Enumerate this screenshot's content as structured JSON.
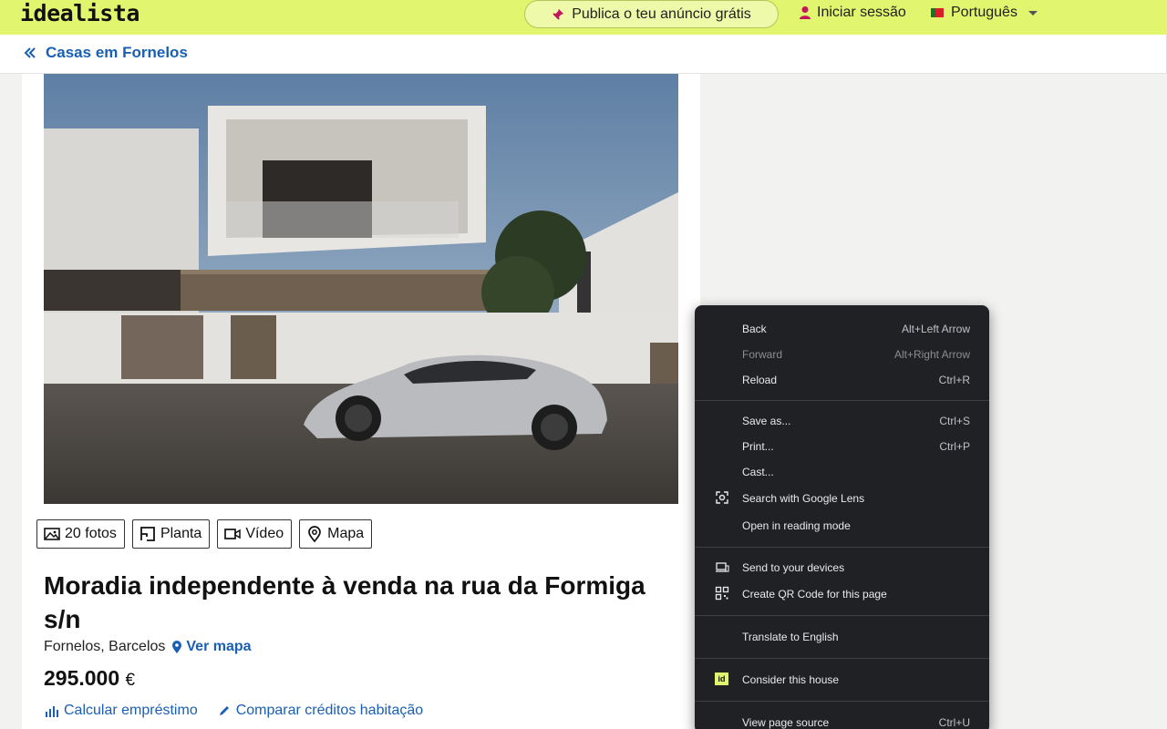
{
  "header": {
    "logo": "idealista",
    "publish_label": "Publica o teu anúncio grátis",
    "login_label": "Iniciar sessão",
    "language_label": "Português"
  },
  "breadcrumb": {
    "label": "Casas em Fornelos"
  },
  "listing": {
    "media_tabs": [
      {
        "label": "20 fotos",
        "icon": "photo-icon"
      },
      {
        "label": "Planta",
        "icon": "floorplan-icon"
      },
      {
        "label": "Vídeo",
        "icon": "video-icon"
      },
      {
        "label": "Mapa",
        "icon": "map-pin-icon"
      }
    ],
    "title": "Moradia independente à venda na rua da Formiga s/n",
    "location": "Fornelos, Barcelos",
    "map_link": "Ver mapa",
    "price": "295.000",
    "currency": "€",
    "loan_link": "Calcular empréstimo",
    "compare_link": "Comparar créditos habitação"
  },
  "context_menu": {
    "groups": [
      [
        {
          "label": "Back",
          "shortcut": "Alt+Left Arrow",
          "disabled": false
        },
        {
          "label": "Forward",
          "shortcut": "Alt+Right Arrow",
          "disabled": true
        },
        {
          "label": "Reload",
          "shortcut": "Ctrl+R",
          "disabled": false
        }
      ],
      [
        {
          "label": "Save as...",
          "shortcut": "Ctrl+S"
        },
        {
          "label": "Print...",
          "shortcut": "Ctrl+P"
        },
        {
          "label": "Cast...",
          "shortcut": ""
        },
        {
          "label": "Search with Google Lens",
          "shortcut": "",
          "icon": "google-lens-icon"
        },
        {
          "label": "Open in reading mode",
          "shortcut": ""
        }
      ],
      [
        {
          "label": "Send to your devices",
          "shortcut": "",
          "icon": "devices-icon"
        },
        {
          "label": "Create QR Code for this page",
          "shortcut": "",
          "icon": "qr-code-icon"
        }
      ],
      [
        {
          "label": "Translate to English",
          "shortcut": ""
        }
      ],
      [
        {
          "label": "Consider this house",
          "shortcut": "",
          "icon": "idealista-extension-icon",
          "badge": "id"
        }
      ],
      [
        {
          "label": "View page source",
          "shortcut": "Ctrl+U"
        }
      ]
    ]
  },
  "colors": {
    "brand_yellow": "#e1f56e",
    "link_blue": "#1a5fb4",
    "menu_bg": "#202124"
  }
}
